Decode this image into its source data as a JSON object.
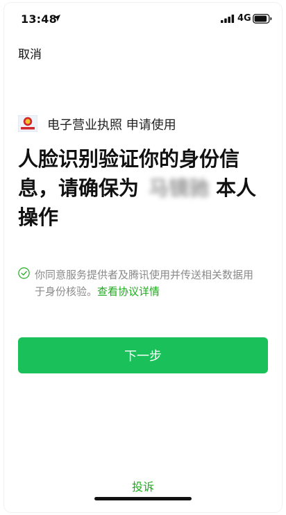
{
  "status_bar": {
    "time": "13:48",
    "network": "4G",
    "icons": [
      "location-arrow-icon",
      "signal-bars-icon",
      "battery-icon"
    ]
  },
  "nav": {
    "cancel_label": "取消"
  },
  "app": {
    "logo_icon": "business-license-emblem-icon",
    "title": "电子营业执照 申请使用"
  },
  "heading": {
    "part1": "人脸识别验证你的身份信息，请确保为",
    "masked_name": "马镜驰",
    "part2": "本人操作"
  },
  "consent": {
    "text": "你同意服务提供者及腾讯使用并传送相关数据用于身份核验。",
    "link_label": "查看协议详情",
    "check_icon": "check-circle-icon"
  },
  "actions": {
    "next_label": "下一步"
  },
  "footer": {
    "complain_label": "投诉"
  },
  "colors": {
    "primary_button": "#1ac05a",
    "link_green": "#1aad19",
    "secondary_text": "#8a8a8a"
  }
}
